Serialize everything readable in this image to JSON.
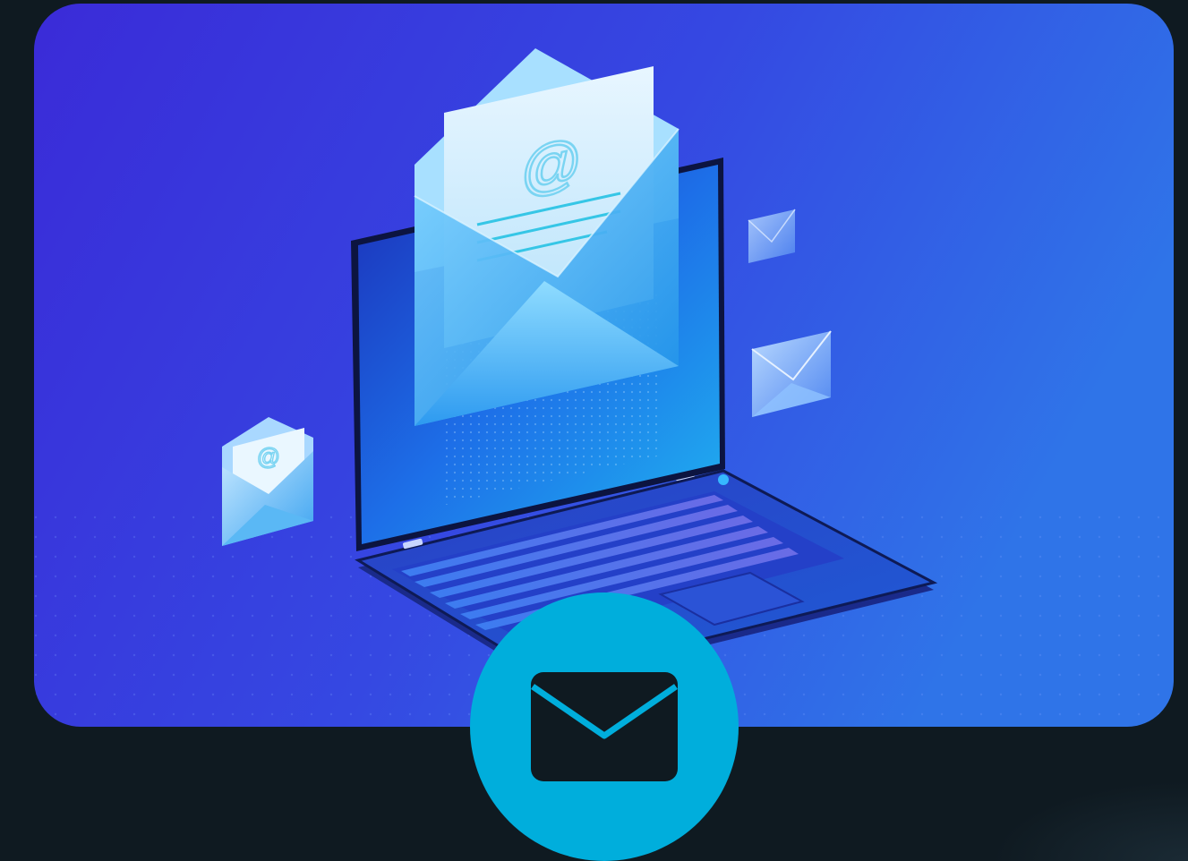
{
  "page": {
    "background_color": "#0f1a21"
  },
  "hero": {
    "gradient_start": "#3a2bd8",
    "gradient_end": "#2f74e8",
    "at_symbol": "@",
    "small_at_symbol": "@"
  },
  "mail_button": {
    "icon": "envelope-icon",
    "circle_color": "#00aedc",
    "icon_color": "#0f1a21"
  }
}
